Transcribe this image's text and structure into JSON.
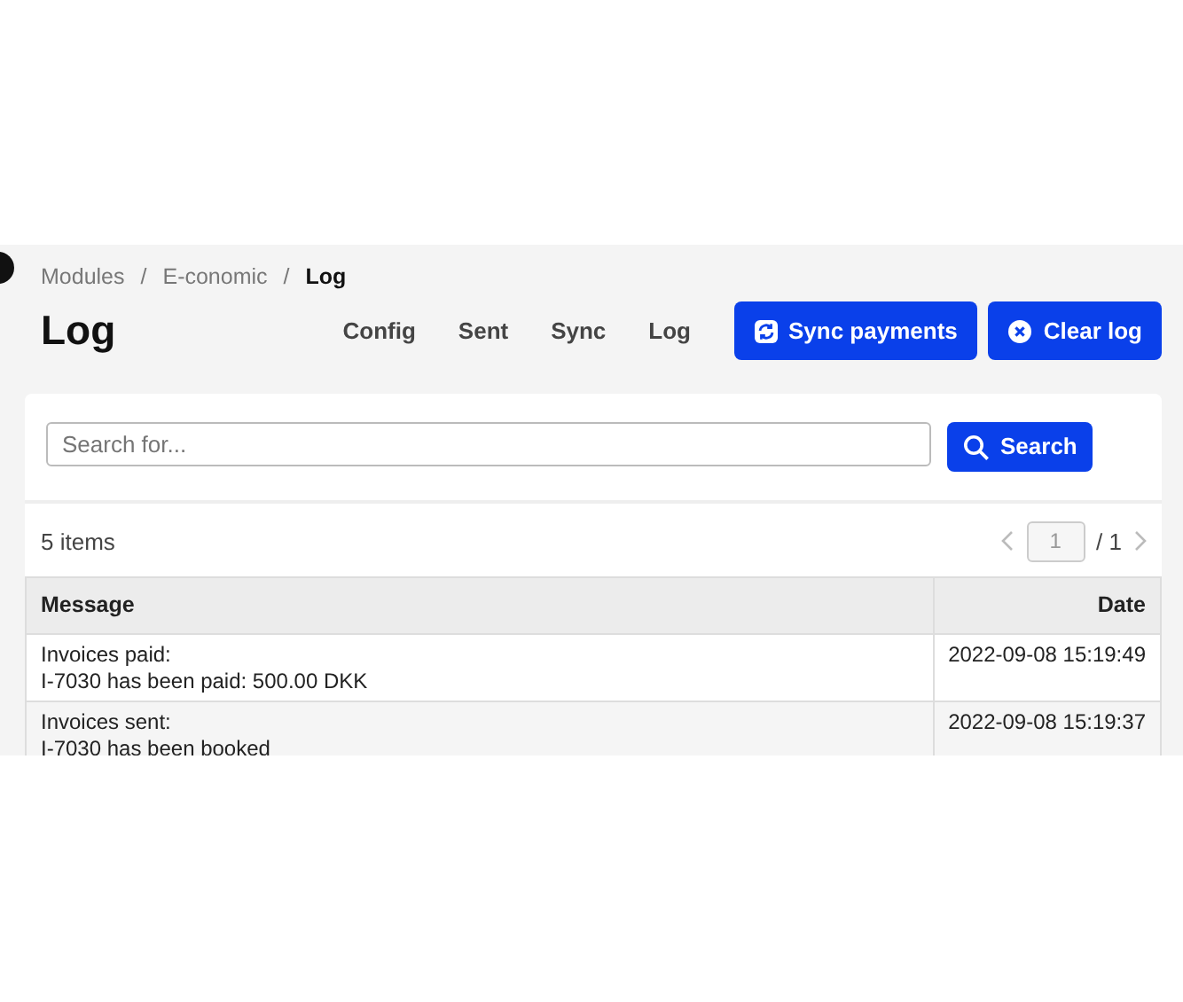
{
  "breadcrumb": [
    {
      "label": "Modules",
      "current": false
    },
    {
      "label": "E-conomic",
      "current": false
    },
    {
      "label": "Log",
      "current": true
    }
  ],
  "breadcrumb_separators": [
    "/",
    "/"
  ],
  "page_title": "Log",
  "nav_links": [
    "Config",
    "Sent",
    "Sync",
    "Log"
  ],
  "buttons": [
    {
      "kind": "sync",
      "label": "Sync payments"
    },
    {
      "kind": "clear",
      "label": "Clear log"
    }
  ],
  "search": {
    "placeholder": "Search for...",
    "button": "Search"
  },
  "item_count": "5 items",
  "pagination": {
    "page": "1",
    "total": "/ 1"
  },
  "table": {
    "columns": [
      "Message",
      "Date"
    ],
    "rows": [
      {
        "message": [
          "Invoices paid:",
          "I-7030 has been paid: 500.00 DKK"
        ],
        "date": "2022-09-08 15:19:49"
      },
      {
        "message": [
          "Invoices sent:",
          "I-7030 has been booked"
        ],
        "date": "2022-09-08 15:19:37"
      }
    ]
  }
}
